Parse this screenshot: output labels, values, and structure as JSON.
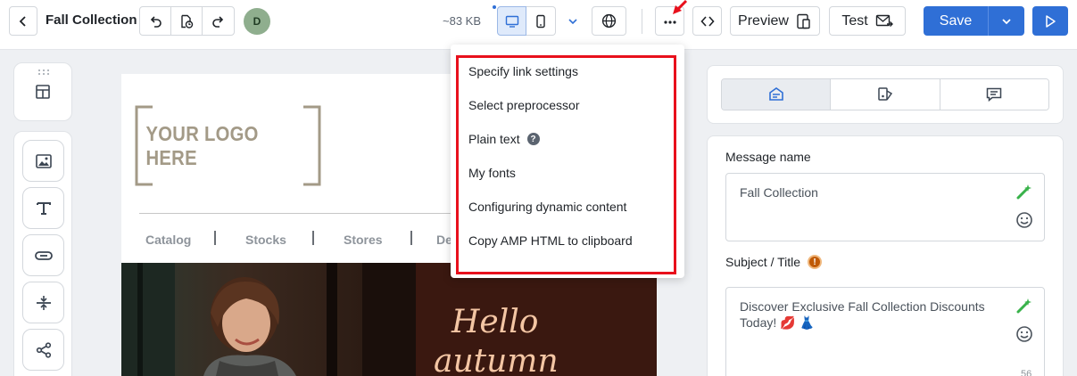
{
  "header": {
    "title": "Fall Collection",
    "avatar_initial": "D",
    "size": "~83 KB",
    "preview_label": "Preview",
    "test_label": "Test",
    "save_label": "Save"
  },
  "canvas": {
    "logo_text": "YOUR LOGO HERE",
    "nav": [
      "Catalog",
      "Stocks",
      "Stores",
      "De"
    ],
    "hero_text": [
      "Hello",
      "autumn"
    ]
  },
  "menu": {
    "items": [
      "Specify link settings",
      "Select preprocessor",
      "Plain text",
      "My fonts",
      "Configuring dynamic content",
      "Copy AMP HTML to clipboard"
    ]
  },
  "panel": {
    "message_name_label": "Message name",
    "message_name_value": "Fall Collection",
    "subject_label": "Subject / Title",
    "subject_value": "Discover Exclusive Fall Collection Discounts Today! 💋 👗",
    "subject_counter": "56"
  },
  "colors": {
    "accent": "#2f6fd6",
    "highlight": "#e8101c",
    "warning": "#c05a06"
  }
}
